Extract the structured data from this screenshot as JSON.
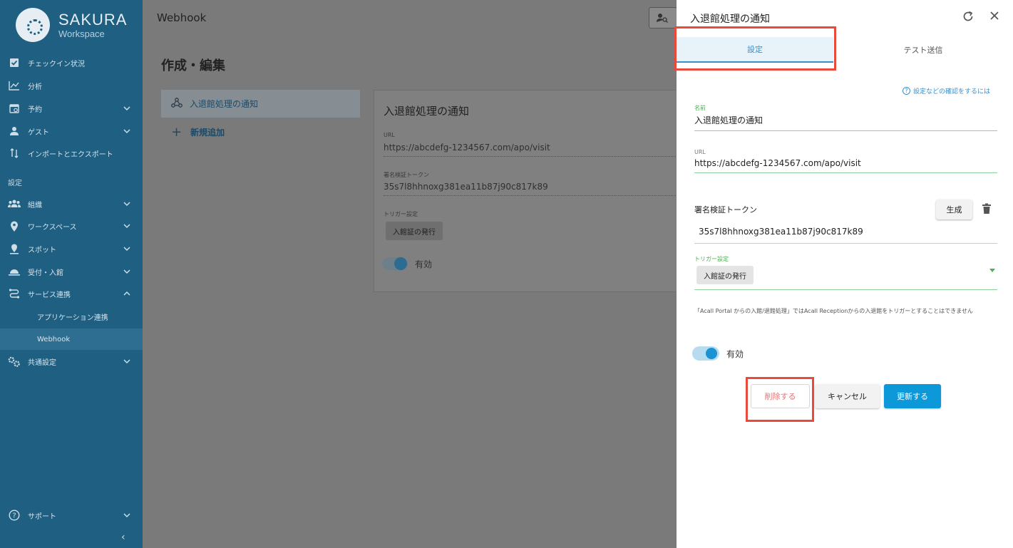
{
  "brand": {
    "title": "SAKURA",
    "subtitle": "Workspace"
  },
  "sidebar": {
    "items": [
      {
        "label": "チェックイン状況",
        "icon": "checkbox-icon",
        "chevron": "none"
      },
      {
        "label": "分析",
        "icon": "chart-icon",
        "chevron": "none"
      },
      {
        "label": "予約",
        "icon": "calendar-icon",
        "chevron": "down"
      },
      {
        "label": "ゲスト",
        "icon": "guest-icon",
        "chevron": "down"
      },
      {
        "label": "インポートとエクスポート",
        "icon": "import-export-icon",
        "chevron": "none"
      }
    ],
    "section_label": "設定",
    "settings_items": [
      {
        "label": "組織",
        "icon": "group-icon",
        "chevron": "down"
      },
      {
        "label": "ワークスペース",
        "icon": "pin-icon",
        "chevron": "down"
      },
      {
        "label": "スポット",
        "icon": "spot-icon",
        "chevron": "down"
      },
      {
        "label": "受付・入館",
        "icon": "reception-icon",
        "chevron": "down"
      },
      {
        "label": "サービス連携",
        "icon": "integration-icon",
        "chevron": "up"
      }
    ],
    "sub_items": [
      {
        "label": "アプリケーション連携",
        "active": false
      },
      {
        "label": "Webhook",
        "active": true
      }
    ],
    "common_settings": {
      "label": "共通設定",
      "icon": "gears-icon",
      "chevron": "down"
    },
    "support": {
      "label": "サポート",
      "icon": "help-icon",
      "chevron": "down"
    },
    "collapse": "‹"
  },
  "main": {
    "topbar_title": "Webhook",
    "page_heading": "作成・編集",
    "list_item": "入退館処理の通知",
    "add_new": "新規追加",
    "card": {
      "title": "入退館処理の通知",
      "url_label": "URL",
      "url_value": "https://abcdefg-1234567.com/apo/visit",
      "token_label": "署名検証トークン",
      "token_value": "35s7l8hhnoxg381ea11b87j90c817k89",
      "trigger_label": "トリガー設定",
      "trigger_value": "入館証の発行",
      "enabled_label": "有効"
    }
  },
  "drawer": {
    "title": "入退館処理の通知",
    "tabs": [
      {
        "label": "設定",
        "active": true
      },
      {
        "label": "テスト送信",
        "active": false
      }
    ],
    "help_link": "設定などの確認をするには",
    "name_label": "名前",
    "name_value": "入退館処理の通知",
    "url_label": "URL",
    "url_value": "https://abcdefg-1234567.com/apo/visit",
    "token_heading": "署名検証トークン",
    "generate_label": "生成",
    "token_value": "35s7l8hhnoxg381ea11b87j90c817k89",
    "trigger_label": "トリガー設定",
    "trigger_value": "入館証の発行",
    "note": "「Acall Portal からの入館/退館処理」ではAcall Receptionからの入退館をトリガーとすることはできません",
    "enabled_label": "有効",
    "enabled": true,
    "buttons": {
      "delete": "削除する",
      "cancel": "キャンセル",
      "update": "更新する"
    }
  },
  "colors": {
    "sidebar": "#1e5f82",
    "accent": "#0c98d9",
    "highlight": "#e84a3c",
    "field_underline": "#8fd19b"
  }
}
